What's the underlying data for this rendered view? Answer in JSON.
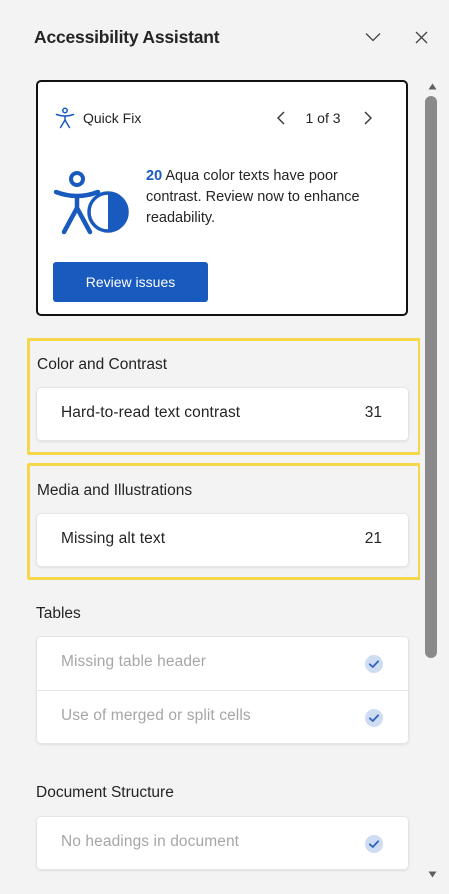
{
  "header": {
    "title": "Accessibility Assistant",
    "collapse_icon": "chevron-down-icon",
    "close_icon": "close-icon"
  },
  "quick_fix": {
    "label": "Quick Fix",
    "icon": "accessibility-person-icon",
    "pager": "1 of 3",
    "prev_icon": "chevron-left-icon",
    "next_icon": "chevron-right-icon",
    "count": "20",
    "message": " Aqua color texts have poor contrast. Review now to enhance readability.",
    "button_label": "Review issues"
  },
  "sections": {
    "color_contrast": {
      "title": "Color and Contrast",
      "items": [
        {
          "label": "Hard-to-read text contrast",
          "count": "31"
        }
      ]
    },
    "media": {
      "title": "Media and Illustrations",
      "items": [
        {
          "label": "Missing alt text",
          "count": "21"
        }
      ]
    },
    "tables": {
      "title": "Tables",
      "items": [
        {
          "label": "Missing table header",
          "status": "resolved"
        },
        {
          "label": "Use of merged or split cells",
          "status": "resolved"
        }
      ]
    },
    "structure": {
      "title": "Document Structure",
      "items": [
        {
          "label": "No headings in document",
          "status": "resolved"
        }
      ]
    }
  },
  "colors": {
    "accent": "#185abd",
    "highlight": "#f4d74a",
    "check_bg": "#cfdcf2",
    "check_mark": "#2f63c0"
  }
}
